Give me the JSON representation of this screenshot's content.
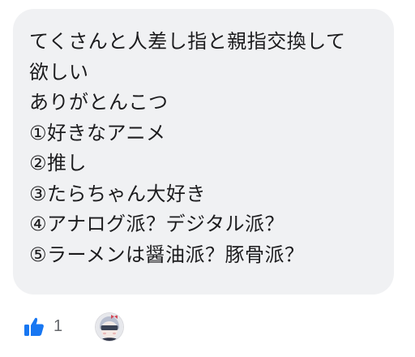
{
  "message": {
    "lines": [
      "てくさんと人差し指と親指交換して",
      "欲しい",
      "ありがとんこつ",
      "①好きなアニメ",
      "②推し",
      "③たらちゃん大好き",
      "④アナログ派？デジタル派？",
      "⑤ラーメンは醤油派？豚骨派？"
    ]
  },
  "reactions": {
    "like_icon": "thumbs-up-icon",
    "like_count": "1",
    "like_color": "#1877f2"
  },
  "colors": {
    "bubble_background": "#f0f1f3",
    "text": "#1c1c1e"
  }
}
